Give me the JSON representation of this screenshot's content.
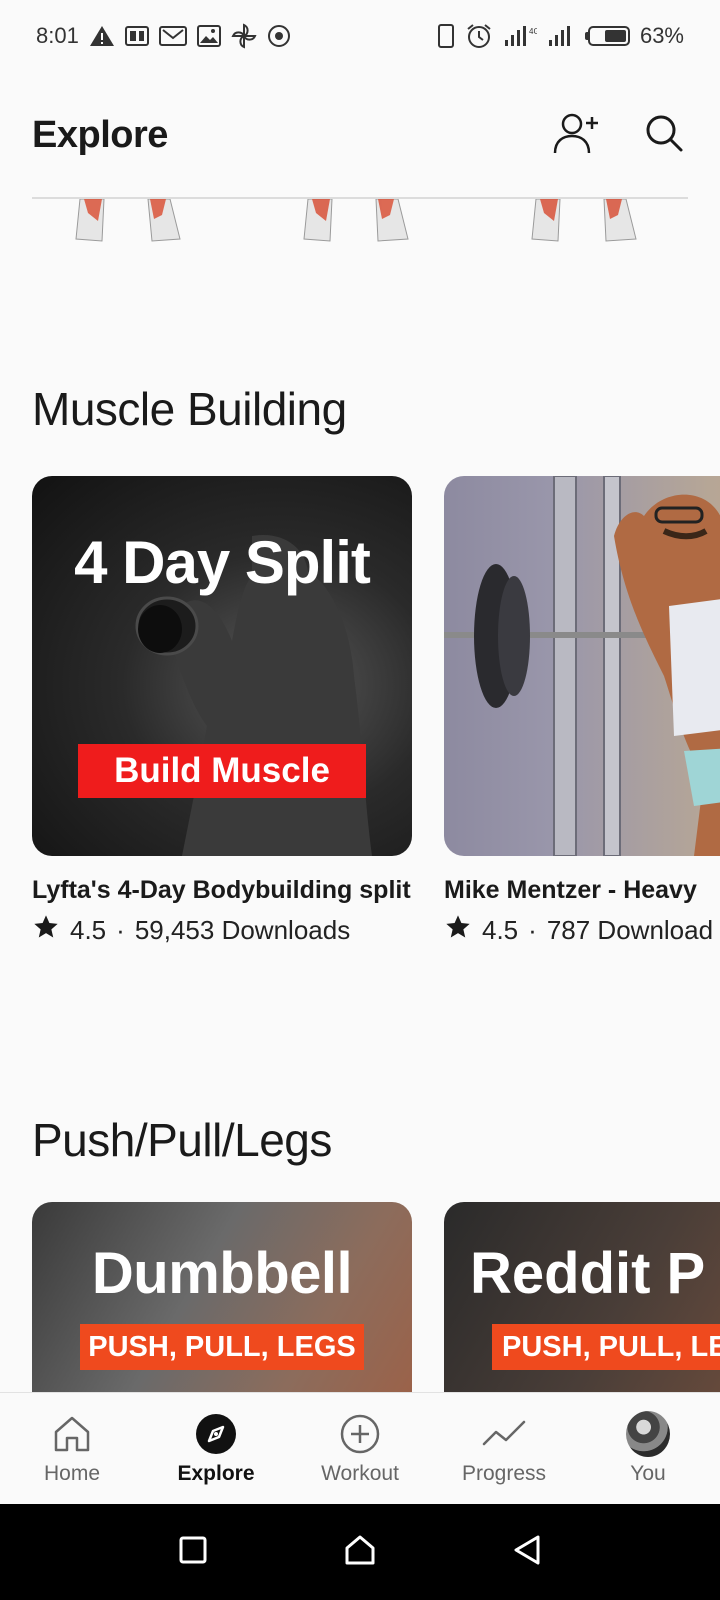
{
  "status_bar": {
    "time": "8:01",
    "battery_percent": "63%",
    "battery_level": 0.63
  },
  "header": {
    "title": "Explore",
    "add_friend_icon": "person-add-icon",
    "search_icon": "search-icon"
  },
  "sections": [
    {
      "title": "Muscle Building",
      "cards": [
        {
          "thumb_headline": "4 Day Split",
          "thumb_banner": "Build Muscle",
          "name": "Lyfta's 4-Day Bodybuilding split",
          "rating": "4.5",
          "downloads": "59,453 Downloads"
        },
        {
          "name": "Mike Mentzer - Heavy",
          "rating": "4.5",
          "downloads": "787 Download"
        }
      ]
    },
    {
      "title": "Push/Pull/Legs",
      "cards": [
        {
          "thumb_headline": "Dumbbell",
          "thumb_banner": "PUSH, PULL, LEGS"
        },
        {
          "thumb_headline": "Reddit P",
          "thumb_banner": "PUSH, PULL, LE"
        }
      ]
    }
  ],
  "meta_separator": "·",
  "bottom_nav": [
    {
      "label": "Home",
      "icon": "home-icon"
    },
    {
      "label": "Explore",
      "icon": "compass-icon",
      "active": true
    },
    {
      "label": "Workout",
      "icon": "plus-circle-icon"
    },
    {
      "label": "Progress",
      "icon": "trend-icon"
    },
    {
      "label": "You",
      "icon": "avatar"
    }
  ],
  "colors": {
    "accent_red": "#ef1c1c",
    "background": "#fafafa",
    "text": "#1a1a1a"
  }
}
